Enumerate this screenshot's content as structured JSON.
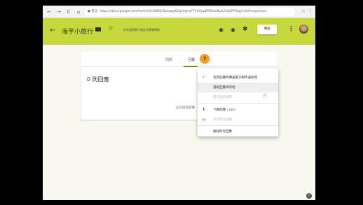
{
  "browser": {
    "url_security": "● 安全",
    "url": "https://docs.google.com/forms/d/1WBQrSaegqyK2qvhtyrxFTmfUpp8P8Sdoftpk2xLQPF0kg/edit#responses",
    "nav_back": "←",
    "nav_forward": "→",
    "nav_reload": "C",
    "home": "⌂",
    "star": "☆",
    "menu": "⋮"
  },
  "appbar": {
    "back": "←",
    "title": "海芋小旅行",
    "star": "☆",
    "saved_status": "所有變更都已儲存至雲端硬碟",
    "palette": "◉",
    "preview": "◉",
    "settings": "✱",
    "send_label": "傳送",
    "more": "⋮"
  },
  "tabs": {
    "questions": "問題",
    "responses": "回覆",
    "responses_count": "7"
  },
  "summary": {
    "title": "0 則回應",
    "accepting_label": "正在接受回覆"
  },
  "menu": {
    "items": [
      {
        "icon": "✓",
        "label": "有新回應時傳送電子郵件通知我",
        "disabled": false
      },
      {
        "icon": "",
        "label": "選取回應目的地",
        "disabled": false
      },
      {
        "icon": "",
        "label": "取消連結表單",
        "disabled": true
      },
      {
        "icon": "⬇",
        "label": "下載回應 (.csv)",
        "disabled": false
      },
      {
        "icon": "🖶",
        "label": "列印所有回應",
        "disabled": true
      },
      {
        "icon": "",
        "label": "刪除所有回應",
        "disabled": false
      }
    ]
  },
  "help": "?",
  "colors": {
    "appbar": "#c6d83c",
    "badge": "#f4a021",
    "tab_underline": "#7b8a0f",
    "background": "#f8f8ee"
  }
}
